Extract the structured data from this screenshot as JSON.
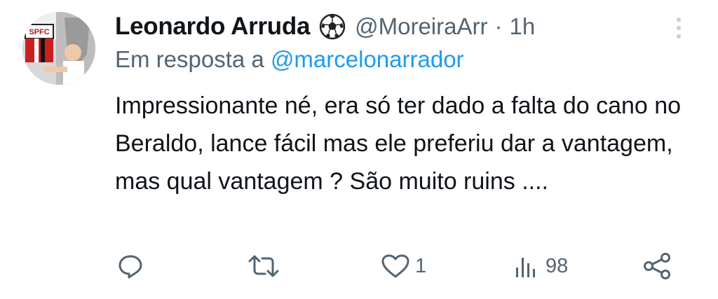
{
  "tweet": {
    "author_name": "Leonardo Arruda",
    "author_emoji_icon": "soccer-ball-icon",
    "handle": "@MoreiraArr",
    "separator": "·",
    "time": "1h",
    "reply_prefix": "Em resposta a",
    "reply_mention": "@marcelonarrador",
    "text": "Impressionante né, era só ter dado a falta do cano no Beraldo, lance fácil mas ele preferiu dar a vantagem, mas qual vantagem ? São muito ruins ....",
    "more_icon": "more-vertical-icon"
  },
  "actions": {
    "reply_icon": "reply-icon",
    "retweet_icon": "retweet-icon",
    "like_icon": "heart-icon",
    "like_count": "1",
    "views_icon": "views-icon",
    "views_count": "98",
    "share_icon": "share-icon"
  },
  "avatar": {
    "logo_text": "SPFC"
  },
  "colors": {
    "text": "#0f1419",
    "muted": "#536471",
    "link": "#1d9bf0"
  }
}
